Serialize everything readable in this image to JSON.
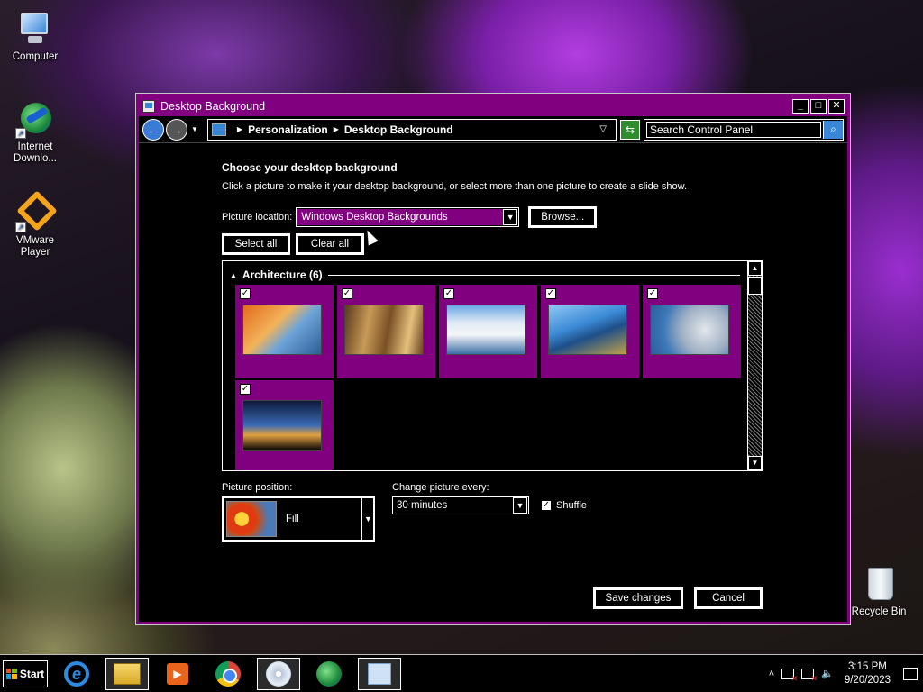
{
  "desktop": {
    "icons": [
      {
        "label": "Computer",
        "icon": "computer-icon"
      },
      {
        "label": "Internet Downlo...",
        "icon": "internet-download-manager-icon"
      },
      {
        "label": "VMware Player",
        "icon": "vmware-player-icon"
      },
      {
        "label": "Recycle Bin",
        "icon": "recycle-bin-icon"
      }
    ]
  },
  "window": {
    "title": "Desktop Background",
    "controls": {
      "minimize": "_",
      "maximize": "□",
      "close": "✕"
    }
  },
  "nav": {
    "back": "←",
    "forward": "→",
    "breadcrumb": [
      "Personalization",
      "Desktop Background"
    ],
    "search_placeholder": "Search Control Panel"
  },
  "main": {
    "heading": "Choose your desktop background",
    "description": "Click a picture to make it your desktop background, or select more than one picture to create a slide show.",
    "location_label": "Picture location:",
    "location_value": "Windows Desktop Backgrounds",
    "browse_label": "Browse...",
    "select_all_label": "Select all",
    "clear_all_label": "Clear all"
  },
  "gallery": {
    "group_title": "Architecture (6)",
    "checked": "✓",
    "items": [
      {
        "checked": true
      },
      {
        "checked": true
      },
      {
        "checked": true
      },
      {
        "checked": true
      },
      {
        "checked": true
      },
      {
        "checked": true
      }
    ]
  },
  "options": {
    "position_label": "Picture position:",
    "position_value": "Fill",
    "change_label": "Change picture every:",
    "change_value": "30 minutes",
    "shuffle_label": "Shuffle",
    "shuffle_checked": true
  },
  "footer": {
    "save_label": "Save changes",
    "cancel_label": "Cancel"
  },
  "taskbar": {
    "start_label": "Start",
    "apps": [
      "internet-explorer-icon",
      "file-explorer-icon",
      "media-player-icon",
      "chrome-icon",
      "disc-burner-icon",
      "internet-download-manager-icon",
      "control-panel-icon"
    ],
    "time": "3:15 PM",
    "date": "9/20/2023"
  },
  "colors": {
    "window_accent": "#800080",
    "background": "#000000",
    "text": "#ffffff"
  }
}
